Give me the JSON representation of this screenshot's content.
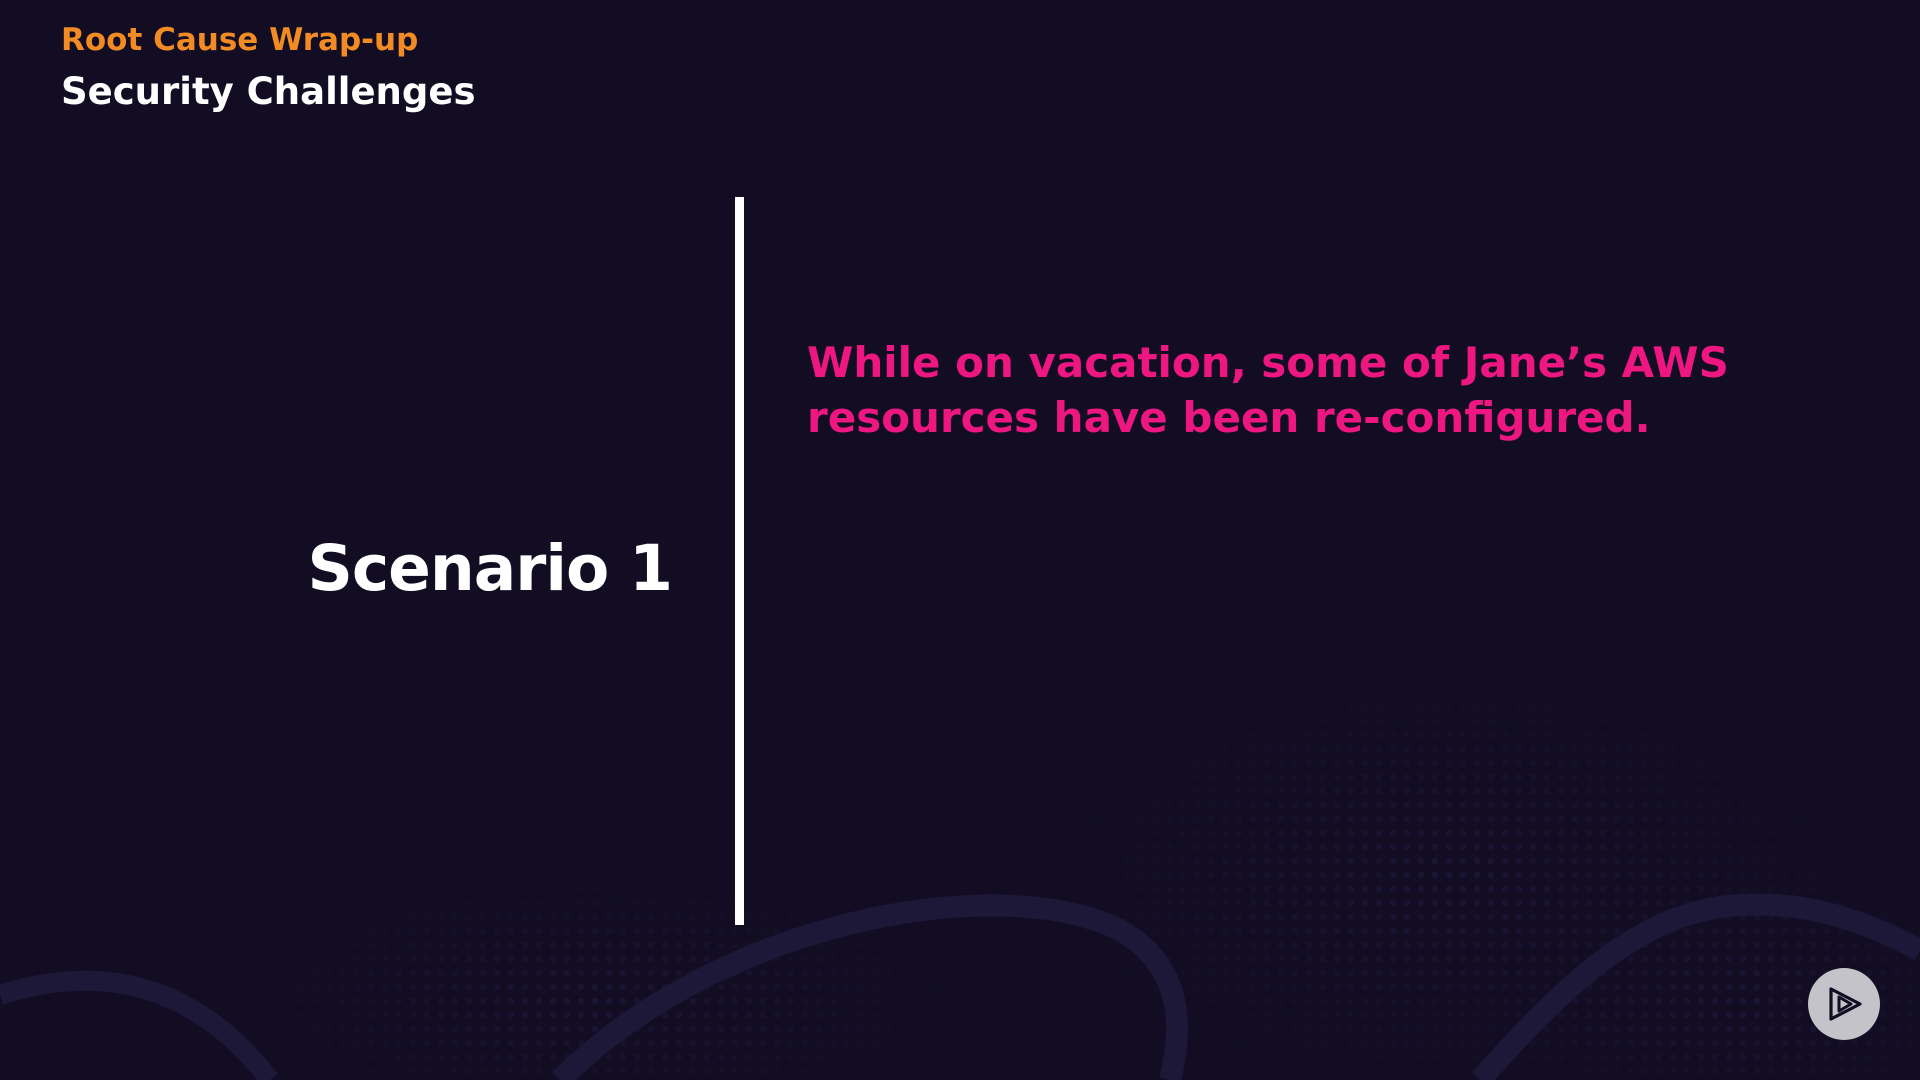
{
  "header": {
    "kicker": "Root Cause Wrap-up",
    "title": "Security Challenges"
  },
  "scenario": {
    "label": "Scenario 1",
    "description": "While on vacation, some of Jane’s AWS resources have been re-configured."
  },
  "colors": {
    "background": "#120d23",
    "kicker": "#f28b24",
    "title": "#ffffff",
    "accent_text": "#ee1781",
    "divider": "#ffffff",
    "play_button_bg": "#c4c3c9"
  },
  "icons": {
    "play_button": "play-logo-icon"
  }
}
